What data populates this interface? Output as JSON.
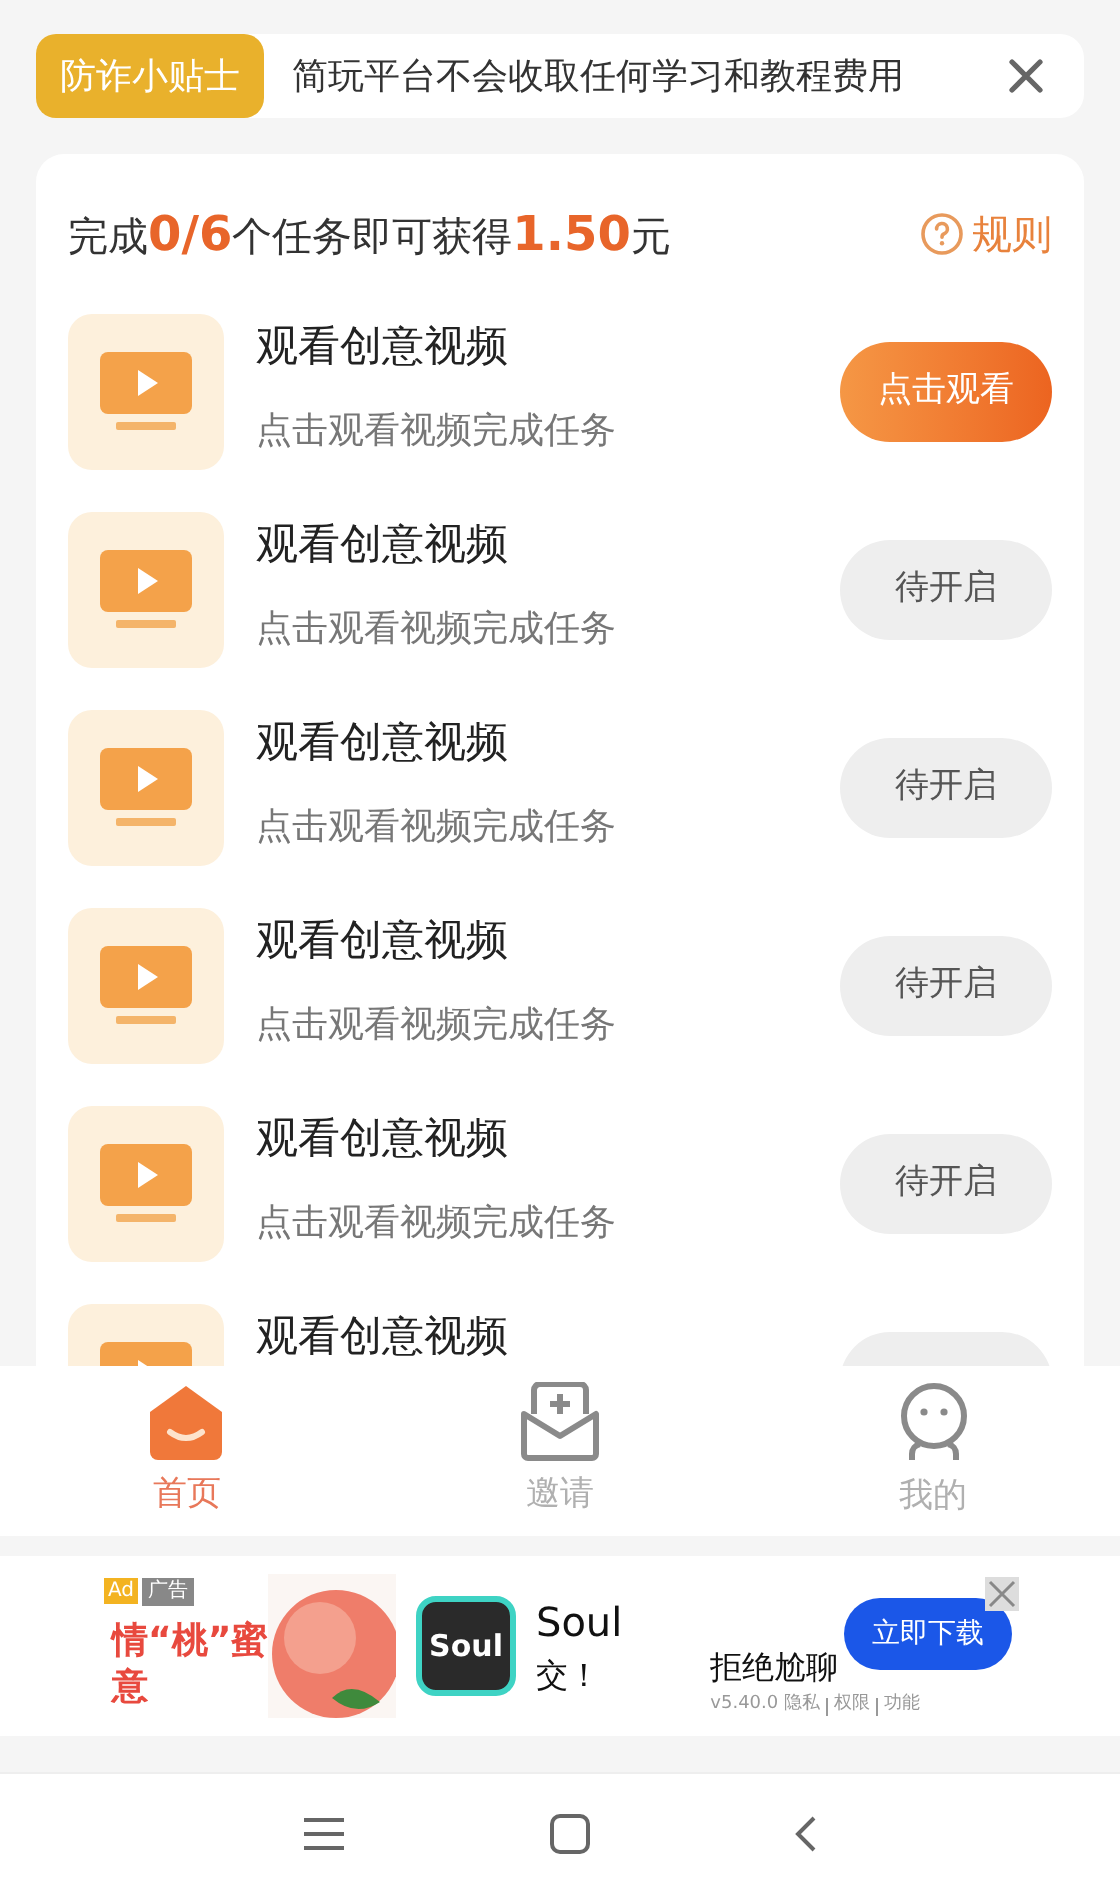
{
  "notice": {
    "tag": "防诈小贴士",
    "text": "简玩平台不会收取任何学习和教程费用"
  },
  "progress": {
    "prefix": "完成",
    "count": "0/6",
    "middle": "个任务即可获得",
    "amount": "1.50",
    "suffix": "元"
  },
  "rules": "规则",
  "tasks": [
    {
      "title": "观看创意视频",
      "subtitle": "点击观看视频完成任务",
      "button": "点击观看",
      "kind": "active"
    },
    {
      "title": "观看创意视频",
      "subtitle": "点击观看视频完成任务",
      "button": "待开启",
      "kind": "pending"
    },
    {
      "title": "观看创意视频",
      "subtitle": "点击观看视频完成任务",
      "button": "待开启",
      "kind": "pending"
    },
    {
      "title": "观看创意视频",
      "subtitle": "点击观看视频完成任务",
      "button": "待开启",
      "kind": "pending"
    },
    {
      "title": "观看创意视频",
      "subtitle": "点击观看视频完成任务",
      "button": "待开启",
      "kind": "pending"
    },
    {
      "title": "观看创意视频",
      "kind": "pending"
    }
  ],
  "tab_bar": [
    {
      "label": "首页",
      "kind": "home",
      "selected": true
    },
    {
      "label": "邀请",
      "kind": "invite",
      "selected": false
    },
    {
      "label": "我的",
      "kind": "me",
      "selected": false
    }
  ],
  "ad": {
    "badge": "Ad",
    "tag": "广告",
    "slogan": "情“桃”蜜意",
    "app_logo": "Soul",
    "app_name": "Soul",
    "app_desc": "交！",
    "headline": "拒绝尬聊",
    "version": "v5.40.0",
    "links": [
      "隐私",
      "权限",
      "功能"
    ],
    "button": "立即下载"
  }
}
